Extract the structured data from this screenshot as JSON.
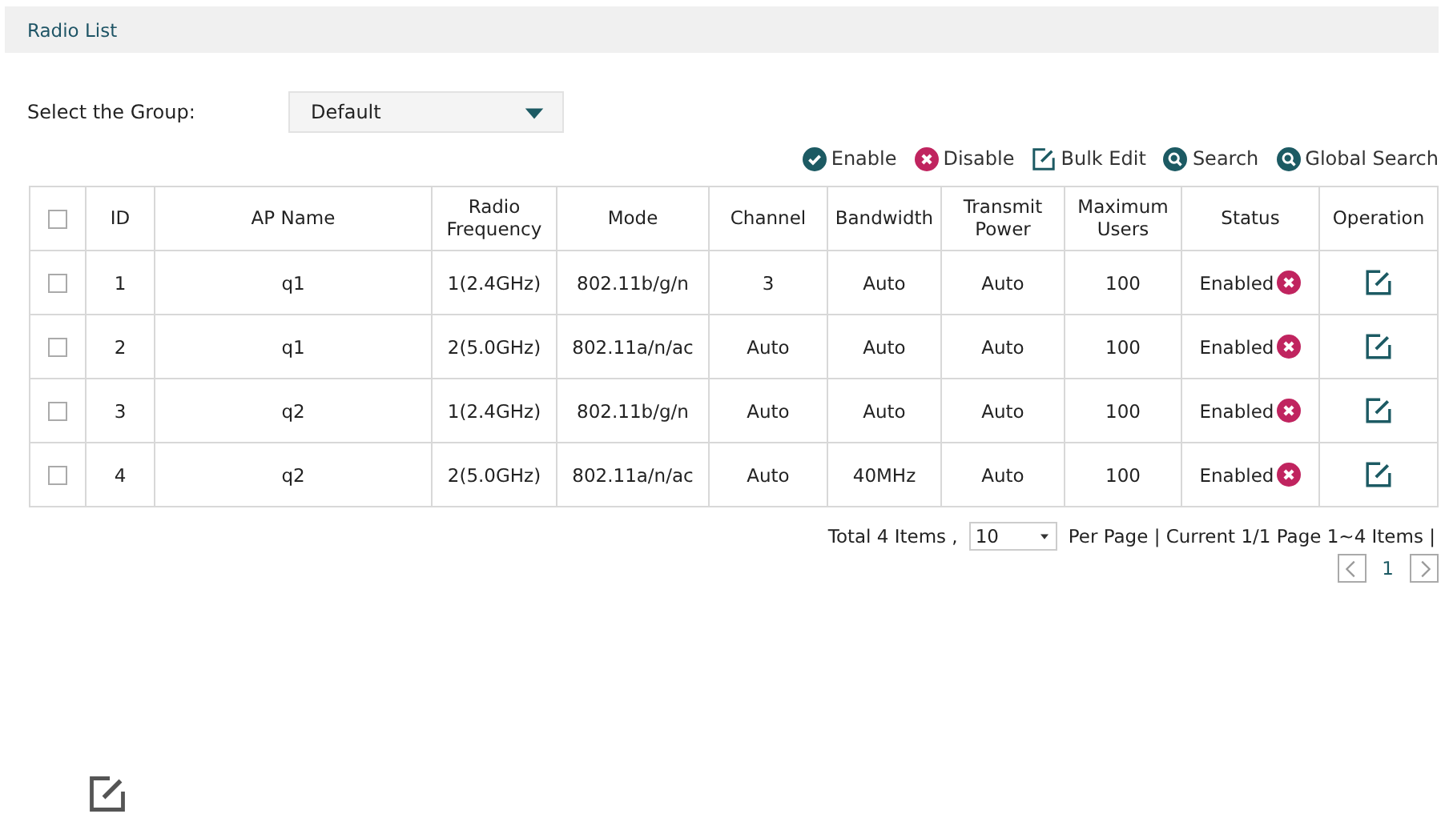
{
  "panel": {
    "title": "Radio List"
  },
  "group_select": {
    "label": "Select the Group:",
    "value": "Default"
  },
  "toolbar": [
    {
      "kind": "enable",
      "label": "Enable"
    },
    {
      "kind": "disable",
      "label": "Disable"
    },
    {
      "kind": "edit",
      "label": "Bulk Edit"
    },
    {
      "kind": "search",
      "label": "Search"
    },
    {
      "kind": "search",
      "label": "Global Search"
    }
  ],
  "table": {
    "select_all_checked": false,
    "columns": [
      "ID",
      "AP Name",
      "Radio Frequency",
      "Mode",
      "Channel",
      "Bandwidth",
      "Transmit Power",
      "Maximum Users",
      "Status",
      "Operation"
    ],
    "rows": [
      {
        "checked": false,
        "cells": [
          "1",
          "q1",
          "1(2.4GHz)",
          "802.11b/g/n",
          "3",
          "Auto",
          "Auto",
          "100"
        ],
        "status": "Enabled"
      },
      {
        "checked": false,
        "cells": [
          "2",
          "q1",
          "2(5.0GHz)",
          "802.11a/n/ac",
          "Auto",
          "Auto",
          "Auto",
          "100"
        ],
        "status": "Enabled"
      },
      {
        "checked": false,
        "cells": [
          "3",
          "q2",
          "1(2.4GHz)",
          "802.11b/g/n",
          "Auto",
          "Auto",
          "Auto",
          "100"
        ],
        "status": "Enabled"
      },
      {
        "checked": false,
        "cells": [
          "4",
          "q2",
          "2(5.0GHz)",
          "802.11a/n/ac",
          "Auto",
          "40MHz",
          "Auto",
          "100"
        ],
        "status": "Enabled"
      }
    ]
  },
  "pagination": {
    "total": "Total 4 Items ,",
    "per_page_value": "10",
    "summary": "Per Page | Current 1/1 Page 1~4 Items |",
    "pages": [
      {
        "label": "1",
        "selected": true
      }
    ]
  }
}
